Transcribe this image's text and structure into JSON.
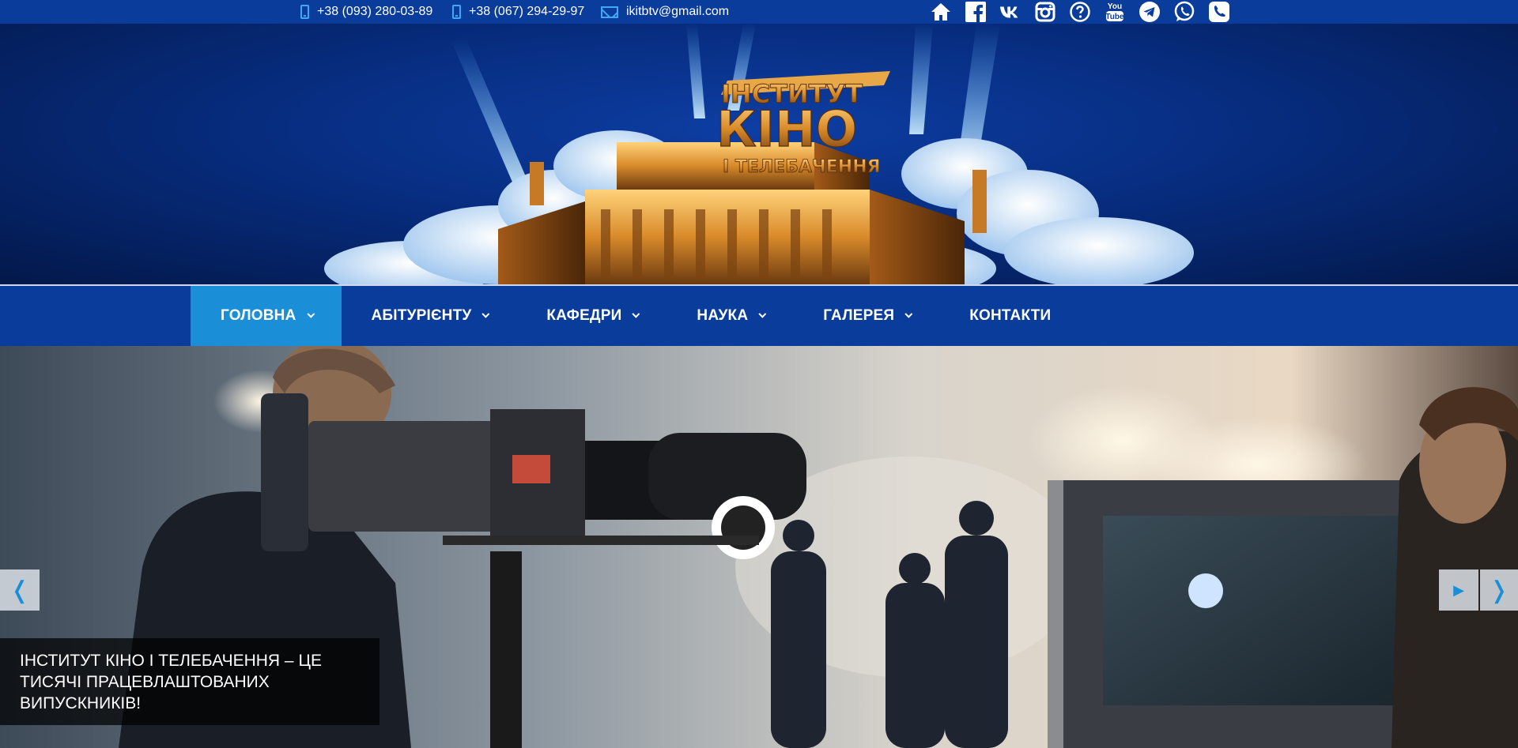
{
  "topbar": {
    "phone1": "+38 (093) 280-03-89",
    "phone2": "+38 (067) 294-29-97",
    "email": "ikitbtv@gmail.com",
    "socials": [
      "home-icon",
      "facebook-icon",
      "vk-icon",
      "instagram-icon",
      "question-icon",
      "youtube-icon",
      "telegram-icon",
      "whatsapp-icon",
      "viber-icon"
    ],
    "youtube_text": "You Tube"
  },
  "logo": {
    "line1": "ІНСТИТУТ",
    "line2": "КІНО",
    "line3": "І ТЕЛЕБАЧЕННЯ"
  },
  "nav": {
    "items": [
      {
        "label": "ГОЛОВНА",
        "active": true,
        "has_dropdown": true
      },
      {
        "label": "АБІТУРІЄНТУ",
        "active": false,
        "has_dropdown": true
      },
      {
        "label": "КАФЕДРИ",
        "active": false,
        "has_dropdown": true
      },
      {
        "label": "НАУКА",
        "active": false,
        "has_dropdown": true
      },
      {
        "label": "ГАЛЕРЕЯ",
        "active": false,
        "has_dropdown": true
      },
      {
        "label": "КОНТАКТИ",
        "active": false,
        "has_dropdown": false
      }
    ]
  },
  "slider": {
    "caption": "Інститут кіно і телебачення – це тисячі працевлаштованих випускників!",
    "prev_icon": "chevron-left-icon",
    "next_icon": "chevron-right-icon",
    "play_icon": "play-icon"
  },
  "colors": {
    "topbar_bg": "#0a3c9c",
    "nav_bg": "#0a3c9c",
    "nav_active": "#1a8fd8",
    "icon_accent": "#3fa9f5"
  }
}
